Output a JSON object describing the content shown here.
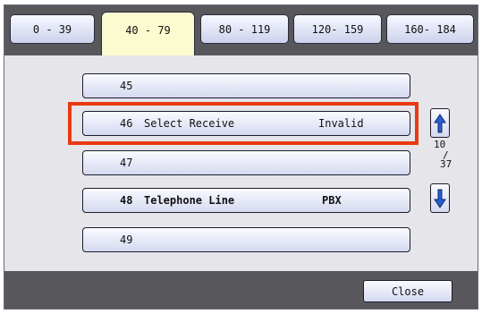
{
  "tabs": [
    {
      "label": "0 - 39"
    },
    {
      "label": "40 - 79",
      "active": true
    },
    {
      "label": "80 - 119"
    },
    {
      "label": "120- 159"
    },
    {
      "label": "160- 184"
    }
  ],
  "rows": [
    {
      "number": "45",
      "label": "",
      "value": ""
    },
    {
      "number": "46",
      "label": "Select Receive",
      "value": "Invalid"
    },
    {
      "number": "47",
      "label": "",
      "value": ""
    },
    {
      "number": "48",
      "label": "Telephone Line",
      "value": "PBX"
    },
    {
      "number": "49",
      "label": "",
      "value": ""
    }
  ],
  "highlighted_row": "46",
  "scroll": {
    "current": "10",
    "separator": "/",
    "total": "37",
    "up_icon": "arrow-up-icon",
    "down_icon": "arrow-down-icon"
  },
  "footer": {
    "close_label": "Close"
  },
  "colors": {
    "bar": "#58585c",
    "panel": "#e6e6ea",
    "active_tab": "#fcfbd0",
    "highlight": "#e83a12",
    "arrow": "#2a5fd0"
  }
}
